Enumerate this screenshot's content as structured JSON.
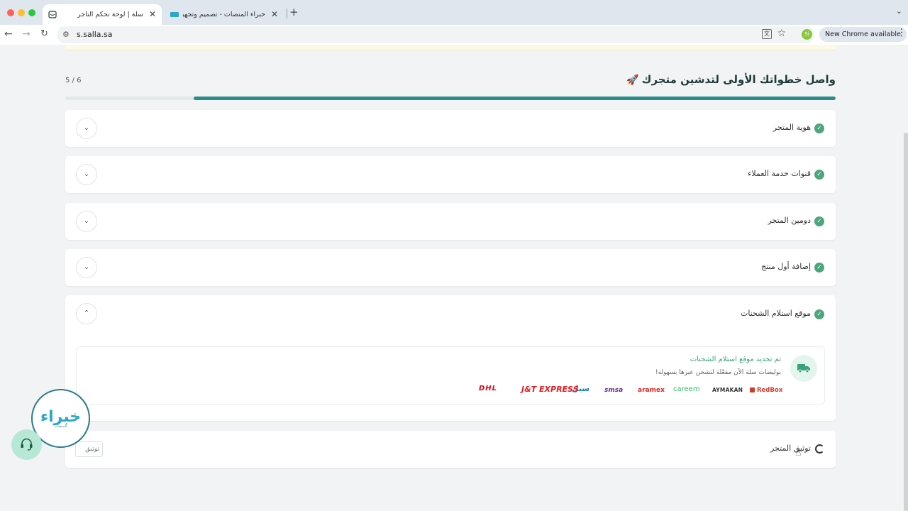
{
  "browser": {
    "tabs": [
      {
        "title": "سلة | لوحة تحكم التاجر",
        "active": true
      },
      {
        "title": "خبراء المنصات - تصميم وتجهيز ال",
        "active": false
      }
    ],
    "url": "s.salla.sa",
    "profile_initials": "Si",
    "update_label": "New Chrome available"
  },
  "onboarding": {
    "heading": "واصل خطواتك الأولى لتدشين متجرك",
    "step_counter": "6 / 5",
    "progress_fraction": 0.833,
    "steps": [
      {
        "label": "هوية المتجر",
        "status": "done",
        "expanded": false
      },
      {
        "label": "قنوات خدمة العملاء",
        "status": "done",
        "expanded": false
      },
      {
        "label": "دومين المتجر",
        "status": "done",
        "expanded": false
      },
      {
        "label": "إضافة أول منتج",
        "status": "done",
        "expanded": false
      },
      {
        "label": "موقع استلام الشحنات",
        "status": "done",
        "expanded": true
      },
      {
        "label": "توثيق المتجر",
        "status": "pending",
        "expanded": false
      }
    ],
    "shipping_panel": {
      "title": "تم تحديد موقع استلام الشحنات",
      "description": "بوليصات سلة الآن مفعّلة لتشحن عبرها بسهولة!",
      "carriers": [
        "RedBox",
        "AYMAKAN",
        "careem",
        "aramex",
        "smsa",
        "سبل",
        "J&T EXPRESS",
        "DHL"
      ]
    },
    "verify_button": "توثيق"
  },
  "colors": {
    "brand_teal": "#2a8c8a",
    "check_green": "#4da57c",
    "success_text": "#3aa27a",
    "support_bg": "#b7e8d6"
  },
  "widgets": {
    "badge_logo": "خبراء",
    "badge_sub": "المنصات",
    "support_icon": "headset-icon"
  }
}
